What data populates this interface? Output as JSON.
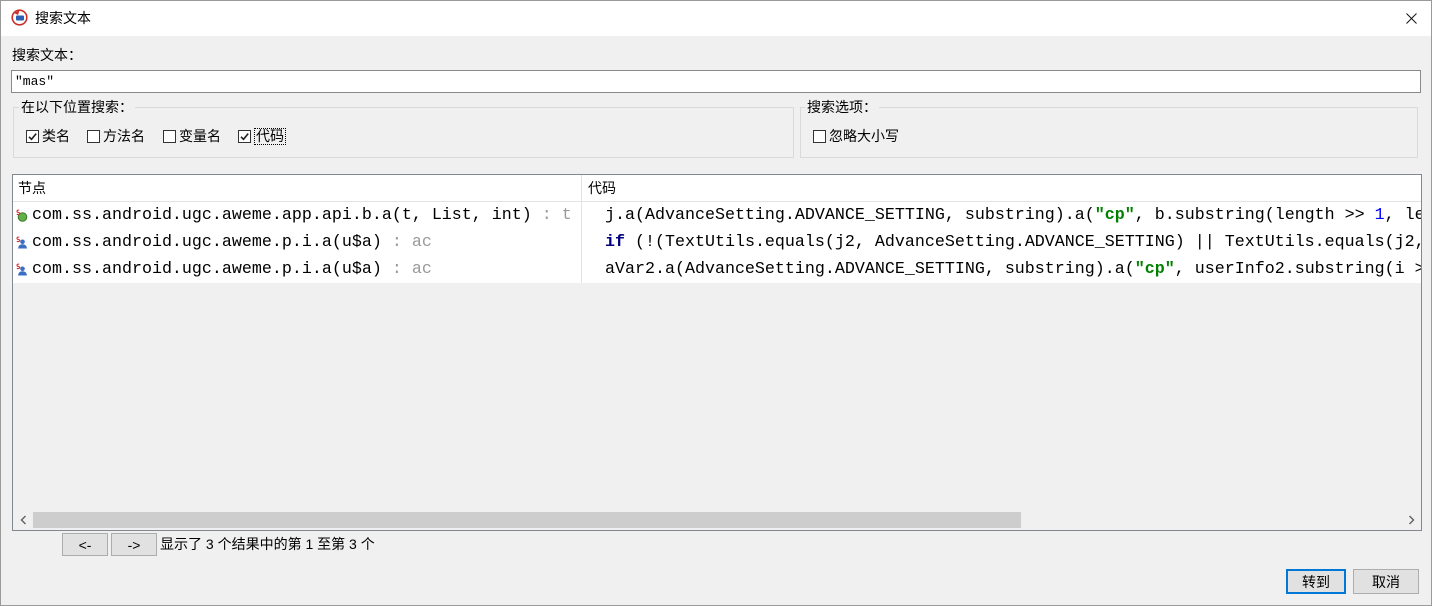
{
  "window": {
    "title": "搜索文本",
    "app_icon": "jadx-logo-icon",
    "close_icon": "close-icon"
  },
  "search": {
    "label": "搜索文本：",
    "value": "\"mas\""
  },
  "location_group": {
    "title": "在以下位置搜索：",
    "options": [
      {
        "label": "类名",
        "checked": true
      },
      {
        "label": "方法名",
        "checked": false
      },
      {
        "label": "变量名",
        "checked": false
      },
      {
        "label": "代码",
        "checked": true
      }
    ]
  },
  "options_group": {
    "title": "搜索选项：",
    "options": [
      {
        "label": "忽略大小写",
        "checked": false
      }
    ]
  },
  "results": {
    "columns": [
      "节点",
      "代码"
    ],
    "rows": [
      {
        "icon": "method-public-icon",
        "node": "com.ss.android.ugc.aweme.app.api.b.a(t, List, int)",
        "node_suffix": " : t",
        "code": [
          {
            "text": "j.a(AdvanceSetting.ADVANCE_SETTING, substring).a(",
            "color": "#000000",
            "bold": false
          },
          {
            "text": "\"cp\"",
            "color": "#008000",
            "bold": true
          },
          {
            "text": ", b.substring(length >> ",
            "color": "#000000",
            "bold": false
          },
          {
            "text": "1",
            "color": "#0000ff",
            "bold": false
          },
          {
            "text": ", le",
            "color": "#000000",
            "bold": false
          }
        ]
      },
      {
        "icon": "method-default-icon",
        "node": "com.ss.android.ugc.aweme.p.i.a(u$a)",
        "node_suffix": " : ac",
        "code": [
          {
            "text": "if",
            "color": "#000080",
            "bold": true
          },
          {
            "text": " (!(TextUtils.equals(j2, AdvanceSetting.ADVANCE_SETTING) || TextUtils.equals(j2,",
            "color": "#000000",
            "bold": false
          }
        ]
      },
      {
        "icon": "method-default-icon",
        "node": "com.ss.android.ugc.aweme.p.i.a(u$a)",
        "node_suffix": " : ac",
        "code": [
          {
            "text": "aVar2.a(AdvanceSetting.ADVANCE_SETTING, substring).a(",
            "color": "#000000",
            "bold": false
          },
          {
            "text": "\"cp\"",
            "color": "#008000",
            "bold": true
          },
          {
            "text": ", userInfo2.substring(i >",
            "color": "#000000",
            "bold": false
          }
        ]
      }
    ]
  },
  "scrollbar": {
    "left_icon": "chevron-left-icon",
    "right_icon": "chevron-right-icon",
    "position": 0,
    "visible_fraction": 0.722
  },
  "pagination": {
    "prev_label": "<-",
    "next_label": "->",
    "status": "显示了 3 个结果中的第 1 至第 3 个"
  },
  "actions": {
    "goto_label": "转到",
    "cancel_label": "取消"
  },
  "colors": {
    "default_button_border": "#0078d7",
    "node_suffix": "#9a9a9a",
    "string_literal": "#008000",
    "keyword": "#000080",
    "number_literal": "#0000ff"
  }
}
